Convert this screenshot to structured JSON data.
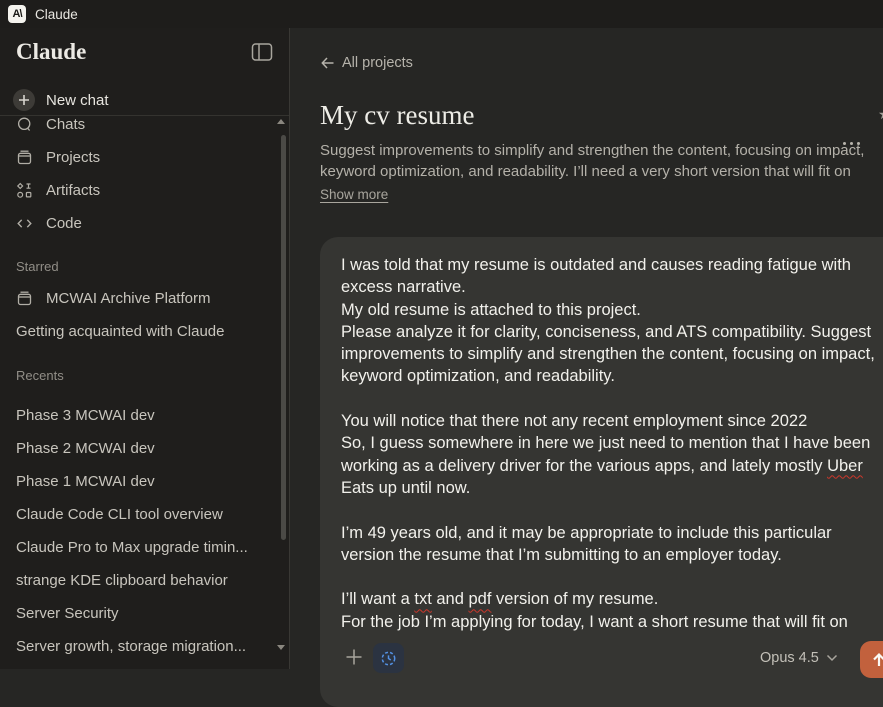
{
  "topbar": {
    "app_title": "Claude"
  },
  "sidebar": {
    "wordmark": "Claude",
    "new_chat_label": "New chat",
    "nav": [
      {
        "label": "Chats"
      },
      {
        "label": "Projects"
      },
      {
        "label": "Artifacts"
      },
      {
        "label": "Code"
      }
    ],
    "sections": {
      "starred_label": "Starred",
      "recents_label": "Recents"
    },
    "starred": [
      {
        "label": "MCWAI Archive Platform"
      },
      {
        "label": "Getting acquainted with Claude"
      }
    ],
    "recents": [
      "Phase 3 MCWAI dev",
      "Phase 2 MCWAI dev",
      "Phase 1 MCWAI dev",
      "Claude Code CLI tool overview",
      "Claude Pro to Max upgrade timin...",
      "strange KDE clipboard behavior",
      "Server Security",
      "Server growth, storage migration..."
    ]
  },
  "project_header": {
    "back_label": "All projects",
    "title": "My cv resume",
    "description": "Suggest improvements to simplify and strengthen the content, focusing on impact, keyword optimization, and readability. I’ll need a very short version that will fit on one...",
    "show_more_label": "Show more"
  },
  "composer": {
    "message": "I was told that my resume is outdated and causes reading fatigue with excess narrative.\nMy old resume is attached to this project.\nPlease analyze it for clarity, conciseness, and ATS compatibility. Suggest improvements to simplify and strengthen the content, focusing on impact, keyword optimization, and readability.\n\nYou will notice that there not any recent employment since 2022\nSo, I guess somewhere in here we just need to mention that I have been working as a delivery driver for the various apps, and lately mostly Uber Eats up until now.\n\nI’m 49 years old, and it may be appropriate to include this particular version the resume that I’m submitting to an employer today.\n\nI’ll want a txt and pdf version of my resume.\nFor the job I’m applying for today, I want a short resume that will fit on",
    "misspelled_words": [
      "Uber",
      "txt",
      "pdf"
    ],
    "model_label": "Opus 4.5"
  },
  "icons": {
    "app_logo": "A\\",
    "new_chat": "+",
    "overflow_menu": "•••",
    "back_arrow": "←",
    "send": "↑",
    "chevron_down": "⌄",
    "edge_star": "★"
  },
  "colors": {
    "topbar_bg": "#1e1d1b",
    "sidebar_bg": "#1f1e1c",
    "main_bg": "#262624",
    "card_bg": "#353532",
    "accent_send_orange": "#c2613d",
    "thinking_blue": "#5391e4",
    "thinking_btn_bg": "#2b3341",
    "spellcheck_red": "#cc372b"
  }
}
